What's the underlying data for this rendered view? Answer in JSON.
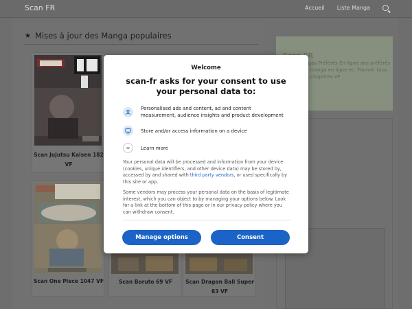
{
  "site": {
    "brand": "Scan FR",
    "nav": [
      "Accueil",
      "Liste Manga"
    ],
    "search_icon": "search-icon"
  },
  "section": {
    "title": "Mises à jour des Manga populaires",
    "icon": "star-icon"
  },
  "cards": [
    {
      "title": "Scan Jujutsu Kaisen 182 VF"
    },
    {
      "title": "Scan One Piece 1047 VF"
    },
    {
      "title": "Scan Boruto 69 VF"
    },
    {
      "title": "Scan Dragon Ball Super 83 VF"
    }
  ],
  "sidebar": {
    "heading": "Scan FR",
    "text": "angas Préférés En ligne   ans préférés de manga en ligne ec. Trouver tous les chapitres VF"
  },
  "consent": {
    "welcome": "Welcome",
    "heading": "scan-fr asks for your consent to use your personal data to:",
    "purposes": [
      {
        "icon": "person-icon",
        "text": "Personalised ads and content, ad and content measurement, audience insights and product development"
      },
      {
        "icon": "device-icon",
        "text": "Store and/or access information on a device"
      }
    ],
    "learn_more": "Learn more",
    "para1_before": "Your personal data will be processed and information from your device (cookies, unique identifiers, and other device data) may be stored by, accessed by and shared with ",
    "para1_link": "third party vendors",
    "para1_after": ", or used specifically by this site or app.",
    "para2": "Some vendors may process your personal data on the basis of legitimate interest, which you can object to by managing your options below. Look for a link at the bottom of this page or in our privacy policy where you can withdraw consent.",
    "manage_button": "Manage options",
    "consent_button": "Consent",
    "accent": "#1b63c6"
  }
}
